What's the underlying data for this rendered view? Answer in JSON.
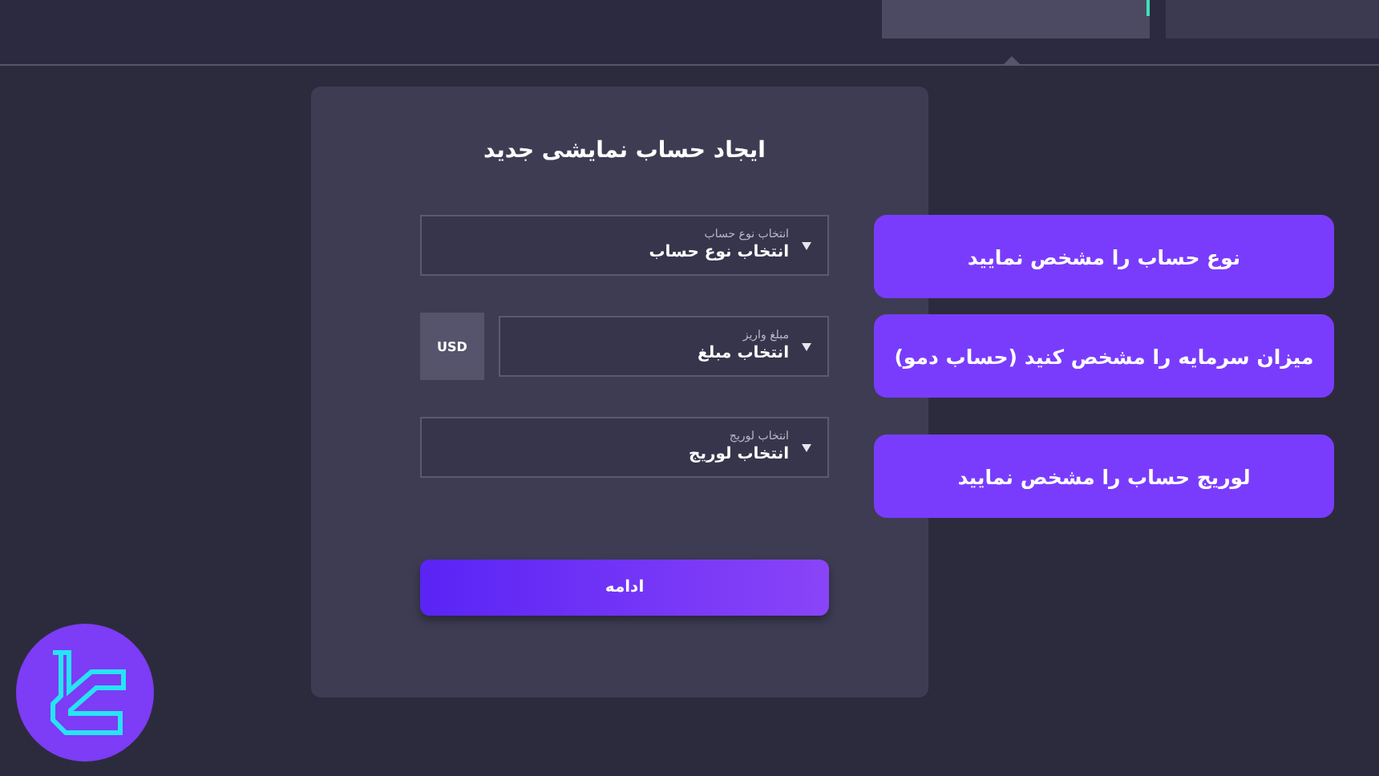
{
  "tabs": [
    {
      "selected": true
    },
    {
      "selected": false
    }
  ],
  "card": {
    "title": "ایجاد حساب نمایشی جدید",
    "fields": [
      {
        "label": "انتخاب نوع حساب",
        "value": "انتخاب نوع حساب"
      },
      {
        "label": "مبلغ واریز",
        "value": "انتخاب مبلغ",
        "currency": "USD"
      },
      {
        "label": "انتخاب لوریج",
        "value": "انتخاب لوریج"
      }
    ],
    "button": "ادامه"
  },
  "callouts": [
    "نوع حساب را مشخص نمایید",
    "میزان سرمایه را مشخص کنید (حساب دمو)",
    "لوریج حساب را مشخص نمایید"
  ]
}
